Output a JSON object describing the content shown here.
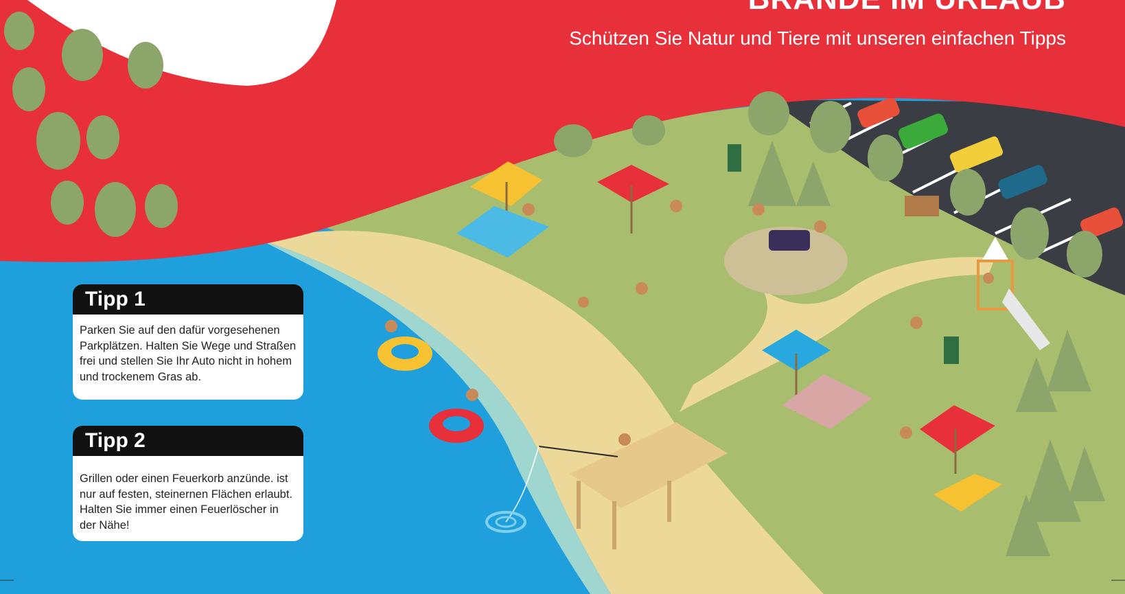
{
  "header": {
    "title": "BRÄNDE IM URLAUB",
    "subtitle": "Schützen Sie Natur und Tiere mit unseren einfachen Tipps"
  },
  "tips": [
    {
      "heading": "Tipp 1",
      "text": "Parken Sie auf den dafür vorgesehenen Parkplätzen. Halten Sie Wege und Straßen frei und stellen Sie Ihr Auto nicht in hohem und trockenem Gras ab."
    },
    {
      "heading": "Tipp 2",
      "text": "Grillen oder einen Feuerkorb anzünde. ist nur auf festen, steinernen Flächen erlaubt. Halten Sie immer einen Feuerlöscher in der Nähe!"
    }
  ],
  "colors": {
    "red": "#e8303a",
    "water": "#29a8df",
    "shallow": "#9fd7d0",
    "sand": "#ecd99a",
    "grass": "#a9bd6e",
    "asphalt": "#3a3d44"
  },
  "illustration": {
    "icons": [
      "tree-icon",
      "umbrella-icon",
      "deck-chair-icon",
      "car-icon",
      "grill-icon",
      "swim-ring-icon",
      "pier-icon",
      "slide-icon",
      "bin-icon",
      "sign-icon",
      "person-icon"
    ]
  }
}
